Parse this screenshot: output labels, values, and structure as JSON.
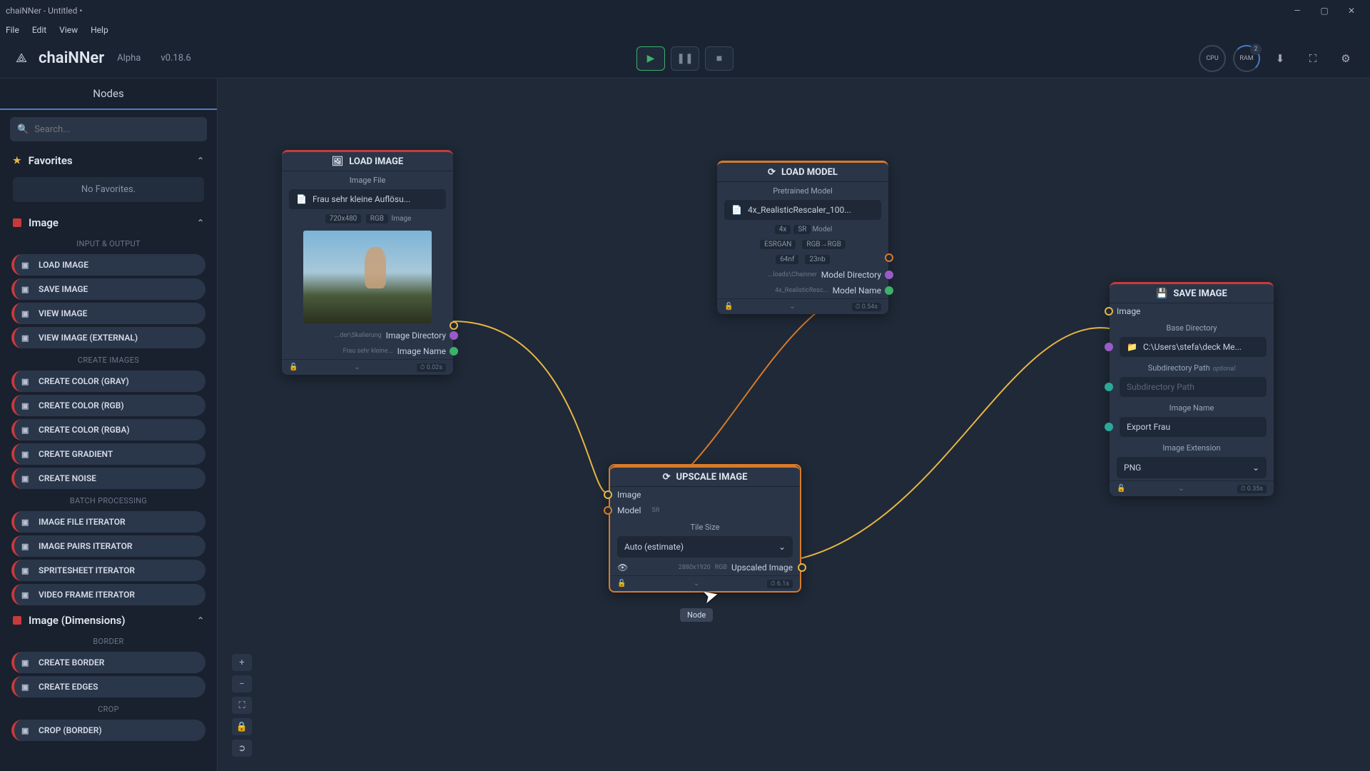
{
  "window": {
    "title": "chaiNNer - Untitled •"
  },
  "menu": {
    "file": "File",
    "edit": "Edit",
    "view": "View",
    "help": "Help"
  },
  "brand": {
    "name": "chaiNNer",
    "alpha": "Alpha",
    "version": "v0.18.6"
  },
  "top_icons": {
    "cpu": "CPU",
    "ram": "RAM",
    "ram_count": "2"
  },
  "sidebar": {
    "tab": "Nodes",
    "search_placeholder": "Search...",
    "favorites": {
      "title": "Favorites",
      "empty": "No Favorites."
    },
    "section_image": {
      "title": "Image",
      "groups": [
        {
          "label": "INPUT & OUTPUT",
          "items": [
            "LOAD IMAGE",
            "SAVE IMAGE",
            "VIEW IMAGE",
            "VIEW IMAGE (EXTERNAL)"
          ]
        },
        {
          "label": "CREATE IMAGES",
          "items": [
            "CREATE COLOR (GRAY)",
            "CREATE COLOR (RGB)",
            "CREATE COLOR (RGBA)",
            "CREATE GRADIENT",
            "CREATE NOISE"
          ]
        },
        {
          "label": "BATCH PROCESSING",
          "items": [
            "IMAGE FILE ITERATOR",
            "IMAGE PAIRS ITERATOR",
            "SPRITESHEET ITERATOR",
            "VIDEO FRAME ITERATOR"
          ]
        }
      ]
    },
    "section_dims": {
      "title": "Image (Dimensions)",
      "groups": [
        {
          "label": "BORDER",
          "items": [
            "CREATE BORDER",
            "CREATE EDGES"
          ]
        },
        {
          "label": "CROP",
          "items": [
            "CROP (BORDER)"
          ]
        }
      ]
    }
  },
  "nodes": {
    "load_image": {
      "title": "LOAD IMAGE",
      "field_label": "Image File",
      "file": "Frau sehr kleine Auflösu...",
      "meta_dims": "720x480",
      "meta_mode": "RGB",
      "meta_out": "Image",
      "dir_pre": "...der\\Skalierung",
      "dir_label": "Image Directory",
      "name_pre": "Frau sehr kleine...",
      "name_label": "Image Name",
      "time": "⏱ 0.02s"
    },
    "load_model": {
      "title": "LOAD MODEL",
      "field_label": "Pretrained Model",
      "file": "4x_RealisticRescaler_100...",
      "scale": "4x",
      "sr": "SR",
      "out": "Model",
      "arch": "ESRGAN",
      "color": "RGB→RGB",
      "nf": "64nf",
      "nb": "23nb",
      "dir_pre": "...loads\\Chainner",
      "dir_label": "Model Directory",
      "name_pre": "4x_RealisticResc...",
      "name_label": "Model Name",
      "time": "⏱ 0.54s"
    },
    "upscale": {
      "title": "UPSCALE IMAGE",
      "in_image": "Image",
      "in_model": "Model",
      "in_model_tag": "SR",
      "tile_label": "Tile Size",
      "tile_value": "Auto (estimate)",
      "out_dims": "2880x1920",
      "out_mode": "RGB",
      "out_label": "Upscaled Image",
      "time": "⏱ 6.1s"
    },
    "save_image": {
      "title": "SAVE IMAGE",
      "in_image": "Image",
      "dir_label": "Base Directory",
      "dir_value": "C:\\Users\\stefa\\deck Me...",
      "sub_label": "Subdirectory Path",
      "sub_opt": "optional",
      "sub_placeholder": "Subdirectory Path",
      "name_label": "Image Name",
      "name_value": "Export Frau",
      "ext_label": "Image Extension",
      "ext_value": "PNG",
      "time": "⏱ 0.35s"
    }
  },
  "tooltip": "Node"
}
